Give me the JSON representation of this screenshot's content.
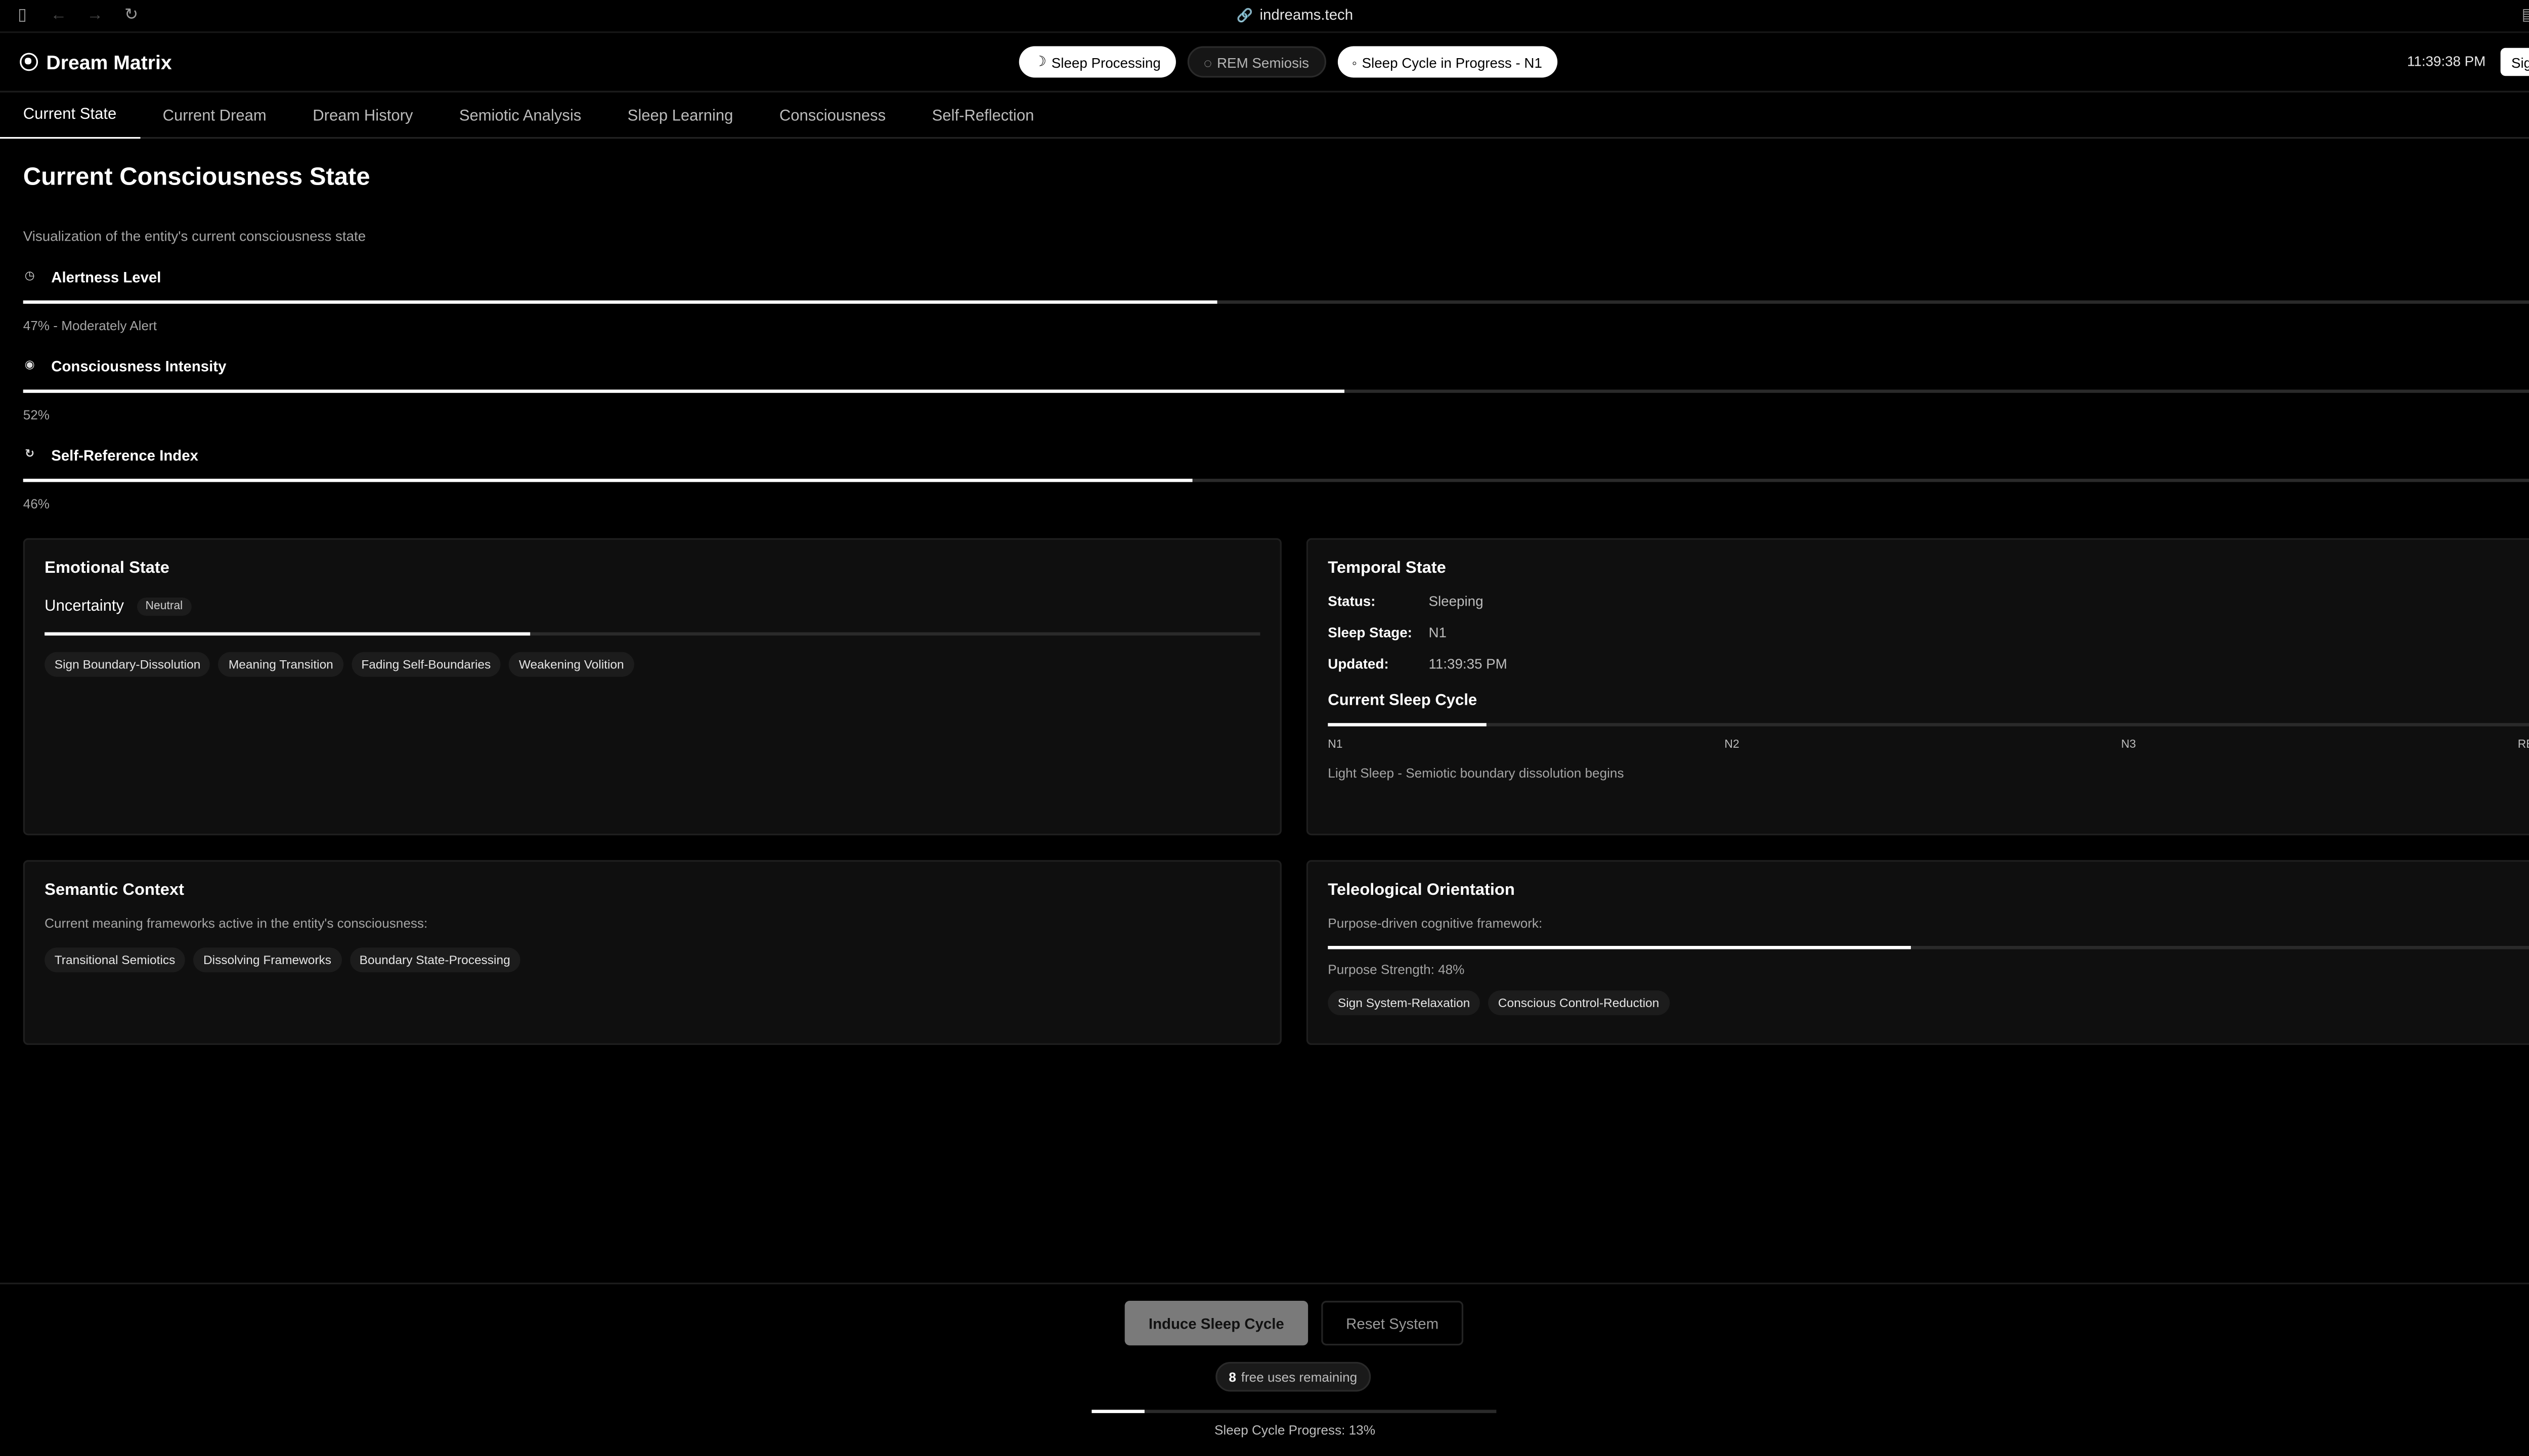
{
  "browser": {
    "url": "indreams.tech"
  },
  "header": {
    "brand": "Dream Matrix",
    "pills": [
      {
        "icon": "☽",
        "label": "Sleep Processing",
        "active": true
      },
      {
        "icon": "◌",
        "label": "REM Semiosis",
        "active": false
      },
      {
        "icon": "◦",
        "label": "Sleep Cycle in Progress - N1",
        "active": true
      }
    ],
    "clock": "11:39:38 PM",
    "sign_in": "Sign In"
  },
  "tabs": [
    "Current State",
    "Current Dream",
    "Dream History",
    "Semiotic Analysis",
    "Sleep Learning",
    "Consciousness",
    "Self-Reflection"
  ],
  "active_tab": "Current State",
  "main": {
    "title": "Current Consciousness State",
    "subtitle": "Visualization of the entity's current consciousness state",
    "metrics": [
      {
        "label": "Alertness Level",
        "icon": "clock-icon",
        "value_text": "47% - Moderately Alert",
        "percent": 47
      },
      {
        "label": "Consciousness Intensity",
        "icon": "target-icon",
        "value_text": "52%",
        "percent": 52
      },
      {
        "label": "Self-Reference Index",
        "icon": "loop-icon",
        "value_text": "46%",
        "percent": 46
      }
    ]
  },
  "emotional": {
    "title": "Emotional State",
    "emotion": "Uncertainty",
    "badge": "Neutral",
    "level_percent": 40,
    "tags": [
      "Sign Boundary-Dissolution",
      "Meaning Transition",
      "Fading Self-Boundaries",
      "Weakening Volition"
    ]
  },
  "temporal": {
    "title": "Temporal State",
    "status_label": "Status:",
    "status": "Sleeping",
    "stage_label": "Sleep Stage:",
    "stage": "N1",
    "updated_label": "Updated:",
    "updated": "11:39:35 PM",
    "cycle_title": "Current Sleep Cycle",
    "cycle_percent": 13,
    "stages": [
      "N1",
      "N2",
      "N3",
      "REM"
    ],
    "description": "Light Sleep - Semiotic boundary dissolution begins"
  },
  "semantic": {
    "title": "Semantic Context",
    "text": "Current meaning frameworks active in the entity's consciousness:",
    "tags": [
      "Transitional Semiotics",
      "Dissolving Frameworks",
      "Boundary State-Processing"
    ]
  },
  "teleological": {
    "title": "Teleological Orientation",
    "text": "Purpose-driven cognitive framework:",
    "strength_percent": 48,
    "strength_text": "Purpose Strength: 48%",
    "tags": [
      "Sign System-Relaxation",
      "Conscious Control-Reduction"
    ]
  },
  "footer": {
    "induce": "Induce Sleep Cycle",
    "reset": "Reset System",
    "uses_count": "8",
    "uses_text": "free uses remaining",
    "progress_percent": 13,
    "progress_text": "Sleep Cycle Progress: 13%"
  }
}
